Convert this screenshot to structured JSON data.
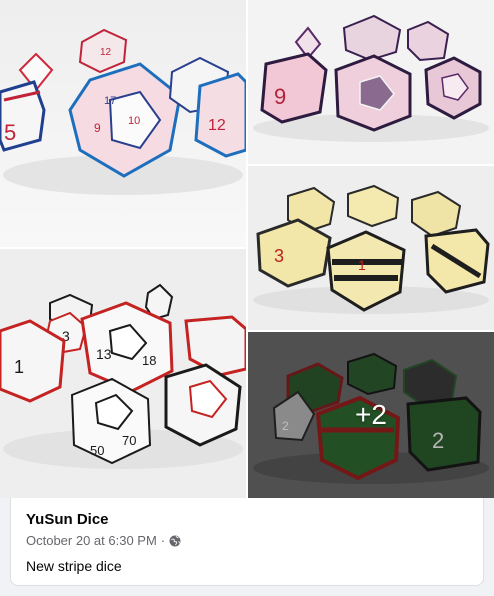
{
  "post": {
    "author": "YuSun Dice",
    "timestamp": "October 20 at 6:30 PM",
    "separator": "·",
    "privacy_icon": "globe-icon",
    "text": "New stripe dice"
  },
  "gallery": {
    "more_count": "+2",
    "photos": [
      {
        "name": "white-blue-pink-dice-photo"
      },
      {
        "name": "purple-pink-dice-photo"
      },
      {
        "name": "white-red-dice-photo"
      },
      {
        "name": "yellow-black-dice-photo"
      },
      {
        "name": "green-red-dice-photo"
      }
    ]
  },
  "colors": {
    "background": "#f0f2f5",
    "card": "#ffffff",
    "text_primary": "#050505",
    "text_secondary": "#65676b"
  }
}
